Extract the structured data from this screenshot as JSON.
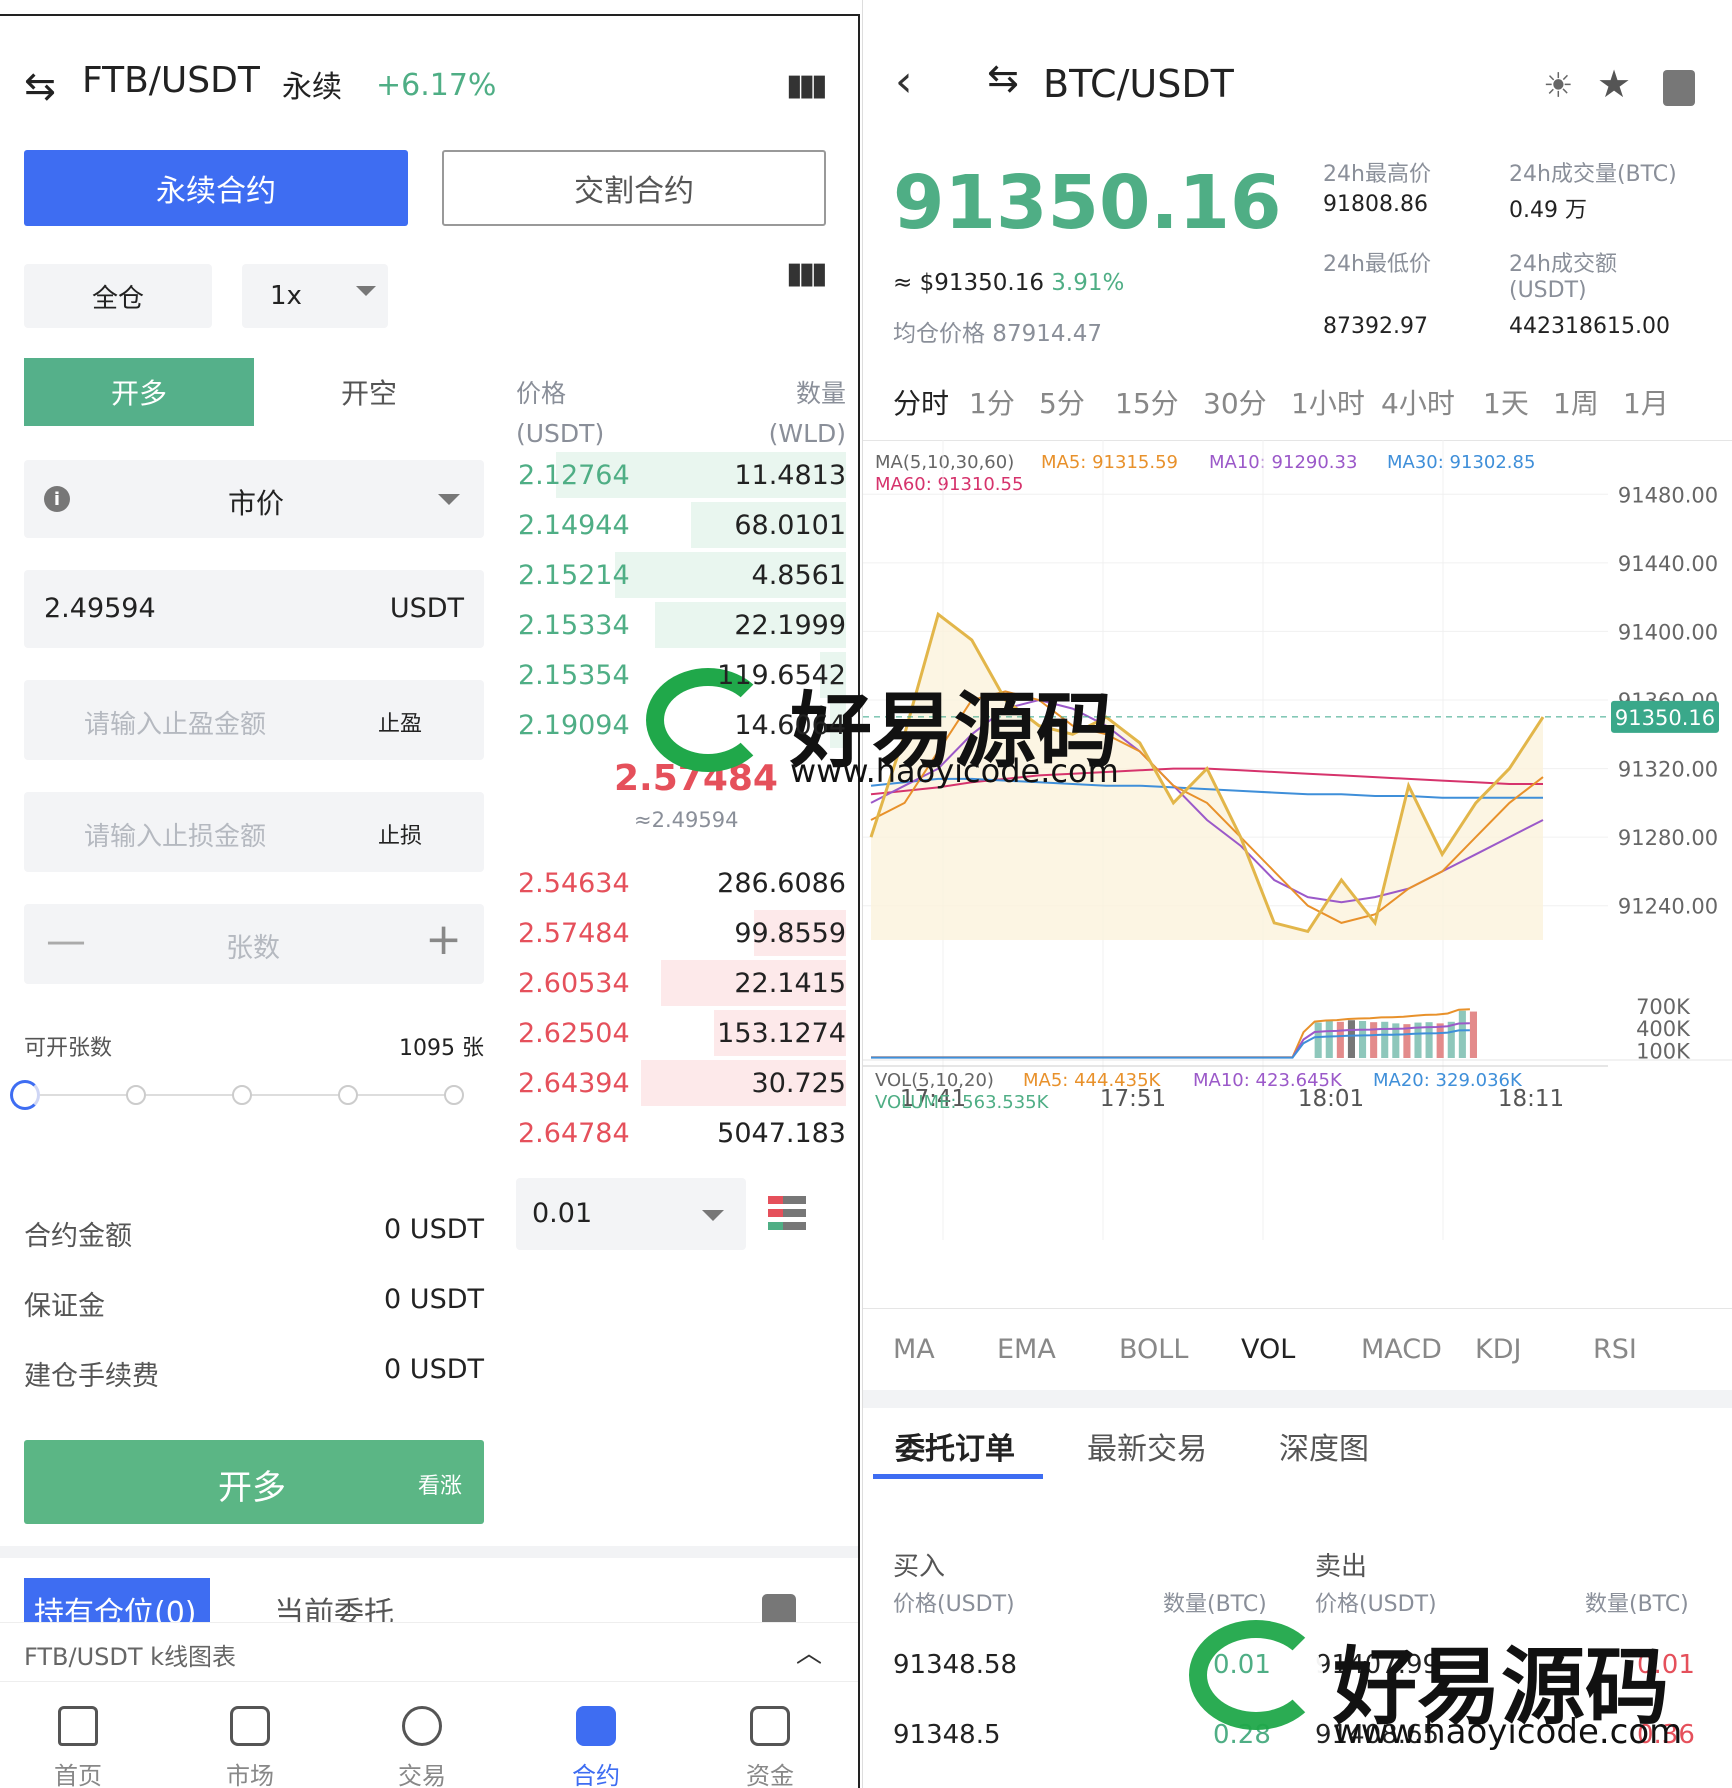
{
  "left": {
    "header": {
      "pair": "FTB/USDT",
      "type": "永续",
      "change": "+6.17%"
    },
    "contract_tabs": [
      "永续合约",
      "交割合约"
    ],
    "margin_mode": "全仓",
    "leverage": "1x",
    "side_tabs": [
      "开多",
      "开空"
    ],
    "order_type": "市价",
    "price_value": "2.49594",
    "price_unit": "USDT",
    "take_profit": {
      "placeholder": "请输入止盈金额",
      "label": "止盈"
    },
    "stop_loss": {
      "placeholder": "请输入止损金额",
      "label": "止损"
    },
    "qty_placeholder": "张数",
    "avail": {
      "label": "可开张数",
      "value": "1095 张"
    },
    "slider_level": 0,
    "summary": [
      {
        "label": "合约金额",
        "value": "0 USDT"
      },
      {
        "label": "保证金",
        "value": "0 USDT"
      },
      {
        "label": "建仓手续费",
        "value": "0 USDT"
      }
    ],
    "submit": {
      "label": "开多",
      "sub": "看涨"
    },
    "position_tabs": [
      "持有仓位(0)",
      "当前委托"
    ],
    "kline_bar": "FTB/USDT k线图表",
    "orderbook": {
      "price_header": "价格",
      "price_unit": "(USDT)",
      "qty_header": "数量",
      "qty_unit": "(WLD)",
      "bids": [
        {
          "p": "2.12764",
          "q": "11.4813",
          "d": 0.88
        },
        {
          "p": "2.14944",
          "q": "68.0101",
          "d": 0.47
        },
        {
          "p": "2.15214",
          "q": "4.8561",
          "d": 0.7
        },
        {
          "p": "2.15334",
          "q": "22.1999",
          "d": 0.58
        },
        {
          "p": "2.15354",
          "q": "119.6542",
          "d": 0.08
        },
        {
          "p": "2.19094",
          "q": "14.6064",
          "d": 0.05
        }
      ],
      "mid_price": "2.57484",
      "mid_sub": "≈2.49594",
      "asks": [
        {
          "p": "2.54634",
          "q": "286.6086",
          "d": 0.0
        },
        {
          "p": "2.57484",
          "q": "99.8559",
          "d": 0.28
        },
        {
          "p": "2.60534",
          "q": "22.1415",
          "d": 0.56
        },
        {
          "p": "2.62504",
          "q": "153.1274",
          "d": 0.4
        },
        {
          "p": "2.64394",
          "q": "30.725",
          "d": 0.62
        },
        {
          "p": "2.64784",
          "q": "5047.183",
          "d": 0.0
        }
      ],
      "precision": "0.01"
    }
  },
  "right": {
    "header": {
      "pair": "BTC/USDT"
    },
    "price": "91350.16",
    "approx": "≈ $91350.16",
    "approx_change": "3.91%",
    "avg_price": "均仓价格 87914.47",
    "stats": {
      "high_label": "24h最高价",
      "high": "91808.86",
      "low_label": "24h最低价",
      "low": "87392.97",
      "vol_label": "24h成交量(BTC)",
      "vol": "0.49 万",
      "amt_label": "24h成交额",
      "amt_label2": "(USDT)",
      "amt": "442318615.00"
    },
    "timeframes": [
      "分时",
      "1分",
      "5分",
      "15分",
      "30分",
      "1小时",
      "4小时",
      "1天",
      "1周",
      "1月"
    ],
    "ma_legend": {
      "ma": "MA(5,10,30,60)",
      "ma5": "MA5: 91315.59",
      "ma10": "MA10: 91290.33",
      "ma30": "MA30: 91302.85",
      "ma60": "MA60: 91310.55"
    },
    "vol_legend": {
      "vol": "VOL(5,10,20)",
      "ma5": "MA5: 444.435K",
      "ma10": "MA10: 423.645K",
      "ma20": "MA20: 329.036K",
      "volume": "VOLUME: 563.535K"
    },
    "indicators": [
      "MA",
      "EMA",
      "BOLL",
      "VOL",
      "MACD",
      "KDJ",
      "RSI"
    ],
    "active_indicator": "VOL",
    "bottom_tabs": [
      "委托订单",
      "最新交易",
      "深度图"
    ],
    "buy_label": "买入",
    "sell_label": "卖出",
    "col_price": "价格(USDT)",
    "col_qty": "数量(BTC)",
    "orders": [
      {
        "bp": "91348.58",
        "bq": "0.01",
        "sp": "91407.99",
        "sq": "0.01"
      },
      {
        "bp": "91348.5",
        "bq": "0.28",
        "sp": "91408.65",
        "sq": "0.36"
      }
    ],
    "watermark": {
      "name": "好易源码",
      "url": "www.haoyicode.com"
    }
  },
  "chart_data": {
    "type": "line",
    "x_ticks": [
      "17:41",
      "17:51",
      "18:01",
      "18:11"
    ],
    "ylim": [
      91220,
      91500
    ],
    "y_ticks": [
      "91480.00",
      "91440.00",
      "91400.00",
      "91360.00",
      "91320.00",
      "91280.00",
      "91240.00"
    ],
    "last": "91350.16",
    "price": [
      91280,
      91340,
      91410,
      91395,
      91360,
      91345,
      91340,
      91350,
      91335,
      91300,
      91320,
      91280,
      91230,
      91225,
      91255,
      91230,
      91310,
      91270,
      91300,
      91320,
      91350
    ],
    "ma5": [
      91290,
      91300,
      91330,
      91360,
      91365,
      91360,
      91345,
      91340,
      91330,
      91310,
      91300,
      91280,
      91260,
      91240,
      91230,
      91235,
      91250,
      91260,
      91280,
      91300,
      91315
    ],
    "ma10": [
      91300,
      91310,
      91320,
      91340,
      91355,
      91360,
      91355,
      91345,
      91330,
      91310,
      91290,
      91275,
      91255,
      91245,
      91242,
      91245,
      91250,
      91260,
      91270,
      91280,
      91290
    ],
    "ma30": [
      91310,
      91312,
      91314,
      91314,
      91313,
      91312,
      91311,
      91310,
      91310,
      91309,
      91308,
      91307,
      91306,
      91305,
      91305,
      91304,
      91304,
      91303,
      91303,
      91303,
      91303
    ],
    "ma60": [
      91305,
      91307,
      91309,
      91312,
      91314,
      91316,
      91317,
      91318,
      91319,
      91320,
      91320,
      91319,
      91318,
      91317,
      91316,
      91315,
      91314,
      91313,
      91312,
      91311,
      91311
    ],
    "vol_ticks": [
      "700K",
      "400K",
      "100K"
    ],
    "volumes": [
      2,
      2,
      2,
      2,
      2,
      2,
      2,
      2,
      2,
      2,
      2,
      2,
      2,
      2,
      2,
      2,
      2,
      2,
      2,
      2,
      2,
      2,
      2,
      2,
      2,
      2,
      2,
      2,
      2,
      2,
      2,
      2,
      2,
      2,
      2,
      2,
      2,
      2,
      2,
      2,
      450,
      470,
      460,
      480,
      470,
      455,
      460,
      440,
      430,
      450,
      455,
      440,
      460,
      600,
      590
    ]
  }
}
